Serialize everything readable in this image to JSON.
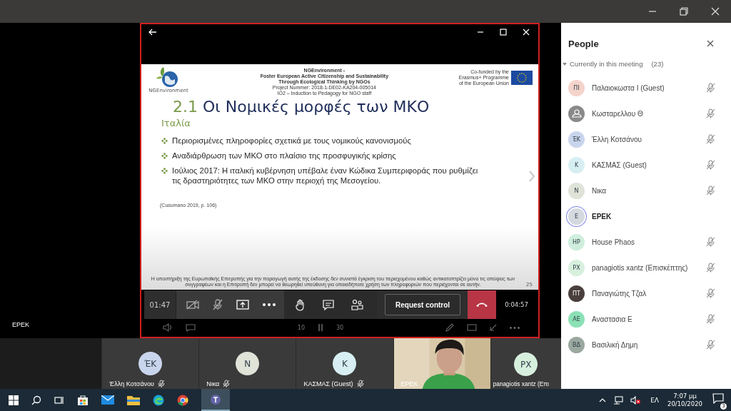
{
  "stage": {
    "presenter_label": "ΕΡΕΚ"
  },
  "slide": {
    "logo_text": "NGEnvironment",
    "header_lines": [
      "NGEnvironment -",
      "Foster European Active Citizenship and Sustainability",
      "Through Ecological Thinking by NGOs",
      "Project Nummer: 2018-1-DE02-KA204-005014",
      "IO2 – Induction to Pedagogy for NGO staff"
    ],
    "eu_lines": [
      "Co-funded by the",
      "Erasmus+ Programme",
      "of the European Union"
    ],
    "number": "2.1",
    "title": "Οι Νομικές μορφές των ΜΚΟ",
    "subtitle": "Ιταλία",
    "bullets": [
      "Περιορισμένες πληροφορίες σχετικά με τους νομικούς κανονισμούς",
      "Αναδιάρθρωση των ΜΚΟ στο πλαίσιο της προσφυγικής κρίσης",
      "Ιούλιος 2017: Η ιταλική κυβέρνηση υπέβαλε έναν Κώδικα Συμπεριφοράς που ρυθμίζει τις δραστηριότητες των ΜΚΟ στην περιοχή της Μεσογείου."
    ],
    "citation": "(Cusumano 2019, p. 106)",
    "disclaimer": "Η υποστήριξη της Ευρωπαϊκής Επιτροπής για την παραγωγή αυτής της έκδοσης δεν συνιστά έγκριση του περιεχομένου καθώς αντικατοπτρίζει μόνο τις απόψεις των συγγραφέων και η Επιτροπή δεν μπορεί να θεωρηθεί υπεύθυνη για οποιαδήποτε χρήση των πληροφοριών που περιέχονται σε αυτήν.",
    "page": "25"
  },
  "toolbar": {
    "elapsed": "01:47",
    "request_control": "Request control",
    "duration": "0:04:57"
  },
  "player": {
    "back": "10",
    "forward": "30"
  },
  "tiles": [
    {
      "kind": "initials",
      "initials": "ΈΚ",
      "name": "Έλλη Κοτσάνου",
      "color": "#c9d5ec",
      "muted": true
    },
    {
      "kind": "initials",
      "initials": "N",
      "name": "Νικα",
      "color": "#dfe3d8",
      "muted": true
    },
    {
      "kind": "initials",
      "initials": "K",
      "name": "ΚΑΣΜΑΣ (Guest)",
      "color": "#d7eff2",
      "muted": true
    },
    {
      "kind": "picture",
      "name": "ΕΡΕΚ",
      "muted": false
    },
    {
      "kind": "initials",
      "initials": "PX",
      "name": "panagiotis xantz (Επι",
      "color": "#d7f0de",
      "muted": false
    }
  ],
  "people": {
    "title": "People",
    "section": "Currently in this meeting",
    "count": "(23)",
    "items": [
      {
        "kind": "initials",
        "initials": "ΠΙ",
        "name": "Παλαιοκωστα Ι (Guest)",
        "color": "#f4d3cb",
        "muted": true,
        "presenting": false
      },
      {
        "kind": "generic",
        "name": "Κωσταρελλου Θ",
        "color": "#8a8a8a",
        "muted": true,
        "presenting": false
      },
      {
        "kind": "initials",
        "initials": "ΈΚ",
        "name": "Έλλη Κοτσάνου",
        "color": "#c9d5ec",
        "muted": true,
        "presenting": false
      },
      {
        "kind": "initials",
        "initials": "K",
        "name": "ΚΑΣΜΑΣ (Guest)",
        "color": "#d7eff2",
        "muted": true,
        "presenting": false
      },
      {
        "kind": "initials",
        "initials": "N",
        "name": "Νικα",
        "color": "#dfe3d8",
        "muted": true,
        "presenting": false
      },
      {
        "kind": "initials",
        "initials": "E",
        "name": "ΕΡΕΚ",
        "color": "#d4d9e0",
        "muted": false,
        "presenting": true
      },
      {
        "kind": "initials",
        "initials": "HP",
        "name": "House Phaos",
        "color": "#cfeedd",
        "muted": true,
        "presenting": false
      },
      {
        "kind": "initials",
        "initials": "PX",
        "name": "panagiotis xantz (Επισκέπτης)",
        "color": "#d7f0de",
        "muted": true,
        "presenting": false
      },
      {
        "kind": "initials",
        "initials": "ΠΤ",
        "name": "Παναγιώτης Τζαλ",
        "color": "#4a3f3c",
        "muted": true,
        "presenting": false
      },
      {
        "kind": "initials",
        "initials": "ΑΕ",
        "name": "Αναστασια Ε",
        "color": "#8ce0b5",
        "muted": true,
        "presenting": false
      },
      {
        "kind": "initials",
        "initials": "ΒΔ",
        "name": "Βασιλική Δημη",
        "color": "#9aa8a0",
        "muted": true,
        "presenting": false
      }
    ]
  },
  "taskbar": {
    "language": "ΕΛ",
    "time": "7:07 μμ",
    "date": "20/10/2020",
    "notifications": "3"
  }
}
